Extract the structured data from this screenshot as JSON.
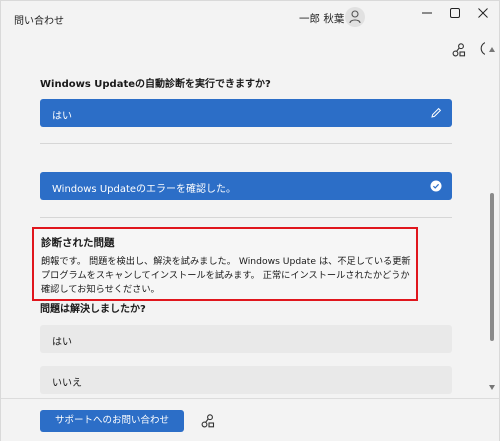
{
  "window": {
    "title": "問い合わせ",
    "user_name": "一郎 秋葉"
  },
  "content": {
    "question1": "Windows Updateの自動診断を実行できますか?",
    "answer1": "はい",
    "answer2": "Windows Updateのエラーを確認した。",
    "diagnosis": {
      "title": "診断された問題",
      "body": "朗報です。 問題を検出し、解決を試みました。 Windows Update は、不足している更新プログラムをスキャンしてインストールを試みます。 正常にインストールされたかどうか確認してお知らせください。"
    },
    "question2": "問題は解決しましたか?",
    "options": [
      "はい",
      "いいえ"
    ]
  },
  "footer": {
    "support_button": "サポートへのお問い合わせ"
  },
  "colors": {
    "accent": "#2c6ec7",
    "highlight": "#e0161d"
  },
  "icons": [
    "person-icon",
    "minimize-icon",
    "maximize-icon",
    "close-icon",
    "hierarchy-icon",
    "info-icon",
    "edit-icon",
    "check-circle-icon"
  ]
}
